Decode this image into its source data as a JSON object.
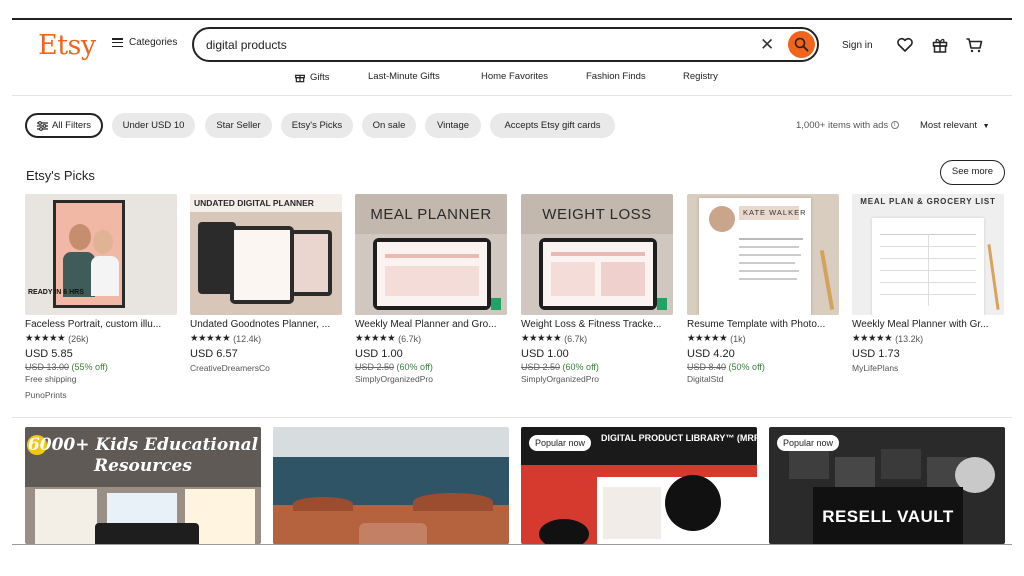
{
  "header": {
    "logo": "Etsy",
    "categories_label": "Categories",
    "search_value": "digital products",
    "signin_label": "Sign in"
  },
  "nav": {
    "items": [
      "Gifts",
      "Last-Minute Gifts",
      "Home Favorites",
      "Fashion Finds",
      "Registry"
    ]
  },
  "filters": {
    "chips": [
      "All Filters",
      "Under USD 10",
      "Star Seller",
      "Etsy's Picks",
      "On sale",
      "Vintage",
      "Accepts Etsy gift cards"
    ],
    "results_count": "1,000+ items with ads",
    "sort_label": "Most relevant"
  },
  "picks": {
    "title": "Etsy's Picks",
    "see_more": "See more",
    "cards": [
      {
        "title": "Faceless Portrait, custom illu...",
        "stars": "★★★★★",
        "reviews": "(26k)",
        "price": "USD 5.85",
        "original": "USD 13.00",
        "discount": "(55% off)",
        "shipping": "Free shipping",
        "shop": "PunoPrints",
        "thumb_text": "READY IN 6 HRS"
      },
      {
        "title": "Undated Goodnotes Planner, ...",
        "stars": "★★★★★",
        "reviews": "(12.4k)",
        "price": "USD 6.57",
        "original": "",
        "discount": "",
        "shipping": "",
        "shop": "CreativeDreamersCo",
        "thumb_text": "UNDATED DIGITAL PLANNER"
      },
      {
        "title": "Weekly Meal Planner and Gro...",
        "stars": "★★★★★",
        "reviews": "(6.7k)",
        "price": "USD 1.00",
        "original": "USD 2.50",
        "discount": "(60% off)",
        "shipping": "",
        "shop": "SimplyOrganizedPro",
        "thumb_text": "MEAL PLANNER"
      },
      {
        "title": "Weight Loss & Fitness Tracke...",
        "stars": "★★★★★",
        "reviews": "(6.7k)",
        "price": "USD 1.00",
        "original": "USD 2.50",
        "discount": "(60% off)",
        "shipping": "",
        "shop": "SimplyOrganizedPro",
        "thumb_text": "WEIGHT LOSS"
      },
      {
        "title": "Resume Template with Photo...",
        "stars": "★★★★★",
        "reviews": "(1k)",
        "price": "USD 4.20",
        "original": "USD 8.40",
        "discount": "(50% off)",
        "shipping": "",
        "shop": "DigitalStd",
        "thumb_text": "KATE WALKER"
      },
      {
        "title": "Weekly Meal Planner with Gr...",
        "stars": "★★★★★",
        "reviews": "(13.2k)",
        "price": "USD 1.73",
        "original": "",
        "discount": "",
        "shipping": "",
        "shop": "MyLifePlans",
        "thumb_text": "MEAL PLAN & GROCERY LIST"
      }
    ]
  },
  "listings": {
    "tiles": [
      {
        "badge": "",
        "text": "6000+ Kids Educational Resources"
      },
      {
        "badge": "",
        "text": ""
      },
      {
        "badge": "Popular now",
        "text": "DIGITAL PRODUCT LIBRARY™ (MRR)"
      },
      {
        "badge": "Popular now",
        "text": "RESELL VAULT"
      }
    ]
  },
  "colors": {
    "brand": "#F1641E",
    "discount_green": "#3a7d3e"
  },
  "icons": [
    "hamburger-icon",
    "search-icon",
    "close-icon",
    "heart-icon",
    "gift-icon",
    "cart-icon",
    "filter-icon",
    "info-icon",
    "caret-down-icon"
  ]
}
